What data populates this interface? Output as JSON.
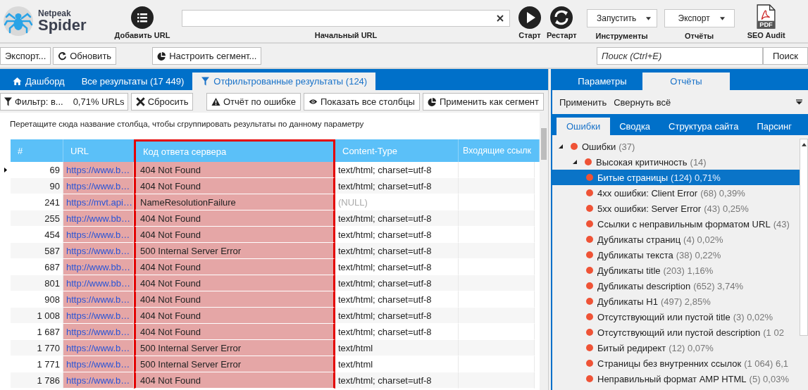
{
  "app": {
    "logo_top": "Netpeak",
    "logo_bottom": "Spider"
  },
  "toolbar": {
    "add_url": "Добавить URL",
    "url_label": "Начальный URL",
    "start": "Старт",
    "restart": "Рестарт",
    "tools": {
      "value": "Запустить",
      "label": "Инструменты"
    },
    "reports": {
      "value": "Экспорт",
      "label": "Отчёты"
    },
    "seo_audit": {
      "label": "SEO Audit",
      "icon_text": "PDF"
    }
  },
  "action_bar": [
    {
      "label": "Экспорт...",
      "kind": "plain"
    },
    {
      "label": "Обновить",
      "kind": "refresh"
    },
    {
      "label": "Настроить сегмент...",
      "kind": "segment"
    }
  ],
  "search": {
    "placeholder": "Поиск (Ctrl+E)",
    "button": "Поиск"
  },
  "left_tabs": [
    {
      "label": "Дашборд",
      "kind": "home",
      "selected": false
    },
    {
      "label": "Все результаты (17 449)",
      "kind": "plain",
      "selected": false
    },
    {
      "label": "Отфильтрованные результаты (124)",
      "kind": "filter",
      "selected": true
    }
  ],
  "filter_bar": {
    "filter": "Фильтр: в...",
    "share": "0,71% URLs",
    "reset": "Сбросить",
    "buttons": [
      {
        "label": "Отчёт по ошибке",
        "kind": "warning"
      },
      {
        "label": "Показать все столбцы",
        "kind": "eye"
      },
      {
        "label": "Применить как сегмент",
        "kind": "segment"
      }
    ]
  },
  "table": {
    "group_hint": "Перетащите сюда название столбца, чтобы сгруппировать результаты по данному параметру",
    "columns": [
      {
        "label": "#",
        "highlighted": false,
        "selected": false
      },
      {
        "label": "URL",
        "highlighted": true,
        "selected": false
      },
      {
        "label": "Код ответа сервера",
        "highlighted": true,
        "selected": true
      },
      {
        "label": "Content-Type",
        "highlighted": false,
        "selected": false
      },
      {
        "label": "Входящие ссылк",
        "highlighted": false,
        "selected": false
      }
    ],
    "rows": [
      {
        "current": true,
        "null_content": false,
        "cells": [
          "69",
          "https://www.b…",
          "404 Not Found",
          "text/html; charset=utf-8"
        ]
      },
      {
        "current": false,
        "null_content": false,
        "cells": [
          "90",
          "https://www.b…",
          "404 Not Found",
          "text/html; charset=utf-8"
        ]
      },
      {
        "current": false,
        "null_content": true,
        "cells": [
          "241",
          "https://mvt.api…",
          "NameResolutionFailure",
          "(NULL)"
        ]
      },
      {
        "current": false,
        "null_content": false,
        "cells": [
          "255",
          "http://www.bb…",
          "404 Not Found",
          "text/html; charset=utf-8"
        ]
      },
      {
        "current": false,
        "null_content": false,
        "cells": [
          "454",
          "https://www.b…",
          "404 Not Found",
          "text/html; charset=utf-8"
        ]
      },
      {
        "current": false,
        "null_content": false,
        "cells": [
          "587",
          "https://www.b…",
          "500 Internal Server Error",
          "text/html; charset=utf-8"
        ]
      },
      {
        "current": false,
        "null_content": false,
        "cells": [
          "687",
          "http://www.bb…",
          "404 Not Found",
          "text/html; charset=utf-8"
        ]
      },
      {
        "current": false,
        "null_content": false,
        "cells": [
          "801",
          "http://www.bb…",
          "404 Not Found",
          "text/html; charset=utf-8"
        ]
      },
      {
        "current": false,
        "null_content": false,
        "cells": [
          "908",
          "https://www.b…",
          "404 Not Found",
          "text/html; charset=utf-8"
        ]
      },
      {
        "current": false,
        "null_content": false,
        "cells": [
          "1 008",
          "https://www.b…",
          "404 Not Found",
          "text/html; charset=utf-8"
        ]
      },
      {
        "current": false,
        "null_content": false,
        "cells": [
          "1 687",
          "https://www.b…",
          "404 Not Found",
          "text/html; charset=utf-8"
        ]
      },
      {
        "current": false,
        "null_content": false,
        "cells": [
          "1 770",
          "https://www.b…",
          "500 Internal Server Error",
          "text/html"
        ]
      },
      {
        "current": false,
        "null_content": false,
        "cells": [
          "1 771",
          "https://www.b…",
          "500 Internal Server Error",
          "text/html"
        ]
      },
      {
        "current": false,
        "null_content": false,
        "cells": [
          "1 786",
          "https://www.b…",
          "404 Not Found",
          "text/html; charset=utf-8"
        ]
      }
    ]
  },
  "right_tabs": [
    {
      "label": "Параметры",
      "selected": false
    },
    {
      "label": "Отчёты",
      "selected": true
    }
  ],
  "report_toolbar": {
    "apply": "Применить",
    "collapse": "Свернуть всё"
  },
  "report_tabs": [
    {
      "label": "Ошибки",
      "selected": true
    },
    {
      "label": "Сводка",
      "selected": false
    },
    {
      "label": "Структура сайта",
      "selected": false
    },
    {
      "label": "Парсинг",
      "selected": false
    }
  ],
  "tree": [
    {
      "label": "Ошибки",
      "count": "(37)",
      "expanded": true,
      "selected": false,
      "children": [
        {
          "label": "Высокая критичность",
          "count": "(14)",
          "expanded": true,
          "selected": false,
          "children": [
            {
              "label": "Битые страницы",
              "count": "(124) 0,71%",
              "selected": true
            },
            {
              "label": "4xx ошибки: Client Error",
              "count": "(68) 0,39%",
              "selected": false
            },
            {
              "label": "5xx ошибки: Server Error",
              "count": "(43) 0,25%",
              "selected": false
            },
            {
              "label": "Ссылки с неправильным форматом URL",
              "count": "(43)",
              "selected": false
            },
            {
              "label": "Дубликаты страниц",
              "count": "(4) 0,02%",
              "selected": false
            },
            {
              "label": "Дубликаты текста",
              "count": "(38) 0,22%",
              "selected": false
            },
            {
              "label": "Дубликаты title",
              "count": "(203) 1,16%",
              "selected": false
            },
            {
              "label": "Дубликаты description",
              "count": "(652) 3,74%",
              "selected": false
            },
            {
              "label": "Дубликаты H1",
              "count": "(497) 2,85%",
              "selected": false
            },
            {
              "label": "Отсутствующий или пустой title",
              "count": "(3) 0,02%",
              "selected": false
            },
            {
              "label": "Отсутствующий или пустой description",
              "count": "(1 02",
              "selected": false
            },
            {
              "label": "Битый редирект",
              "count": "(12) 0,07%",
              "selected": false
            },
            {
              "label": "Страницы без внутренних ссылок",
              "count": "(1 064) 6,1",
              "selected": false
            },
            {
              "label": "Неправильный формат AMP HTML",
              "count": "(5) 0,03%",
              "selected": false
            }
          ]
        }
      ]
    }
  ]
}
